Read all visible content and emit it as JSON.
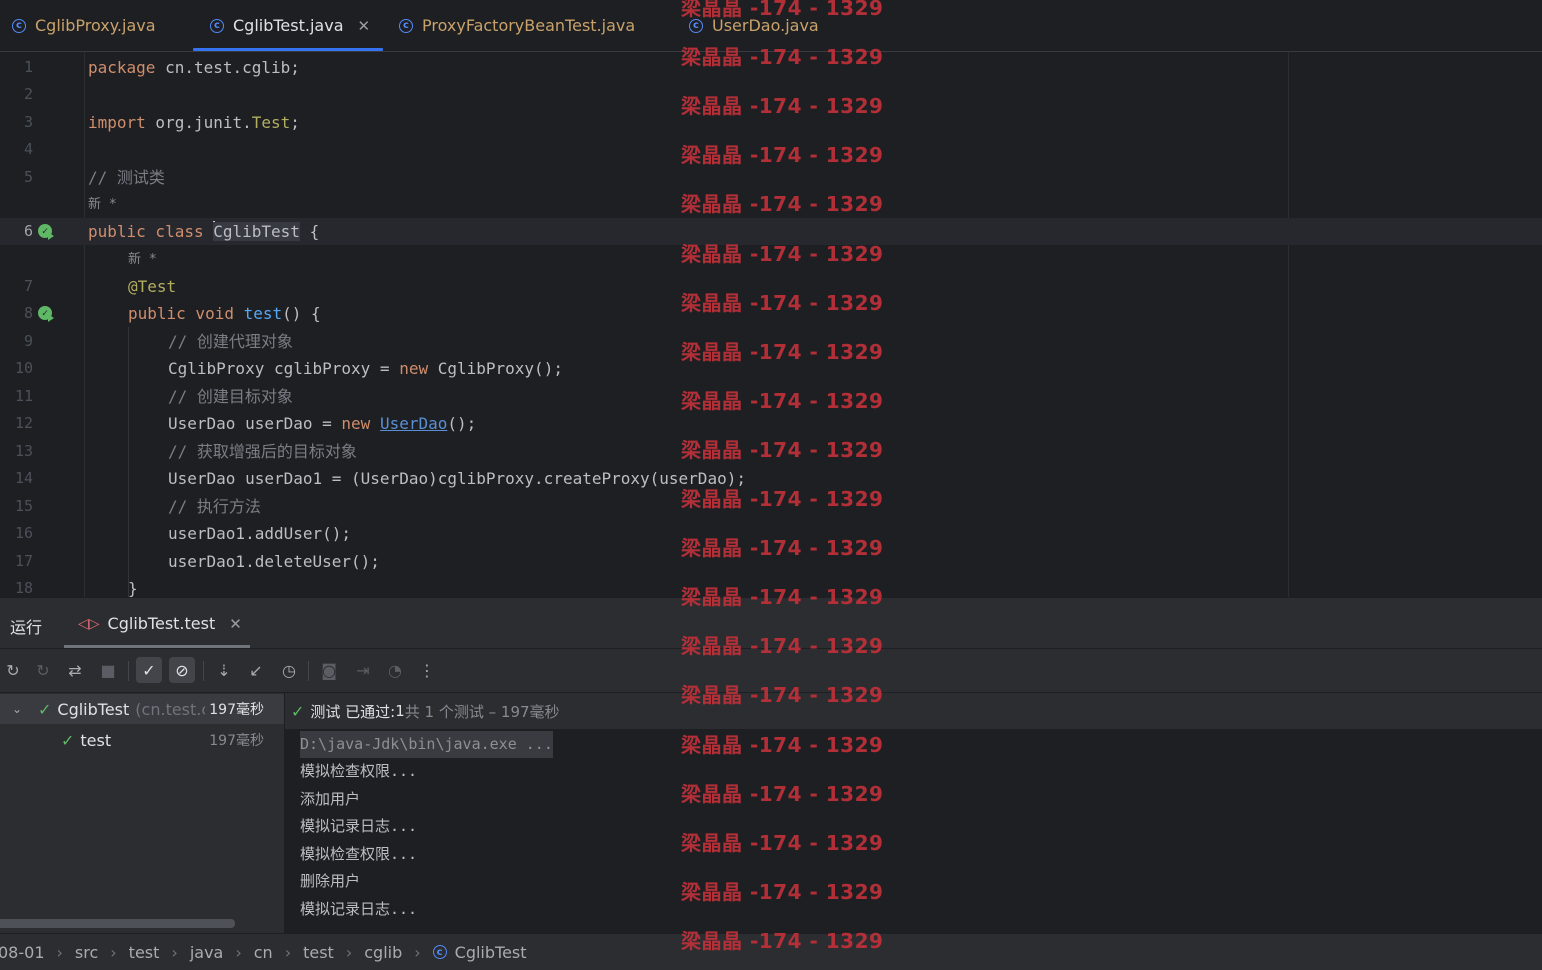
{
  "tabs": [
    {
      "label": "CglibProxy.java",
      "active": false
    },
    {
      "label": "CglibTest.java",
      "active": true
    },
    {
      "label": "ProxyFactoryBeanTest.java",
      "active": false
    },
    {
      "label": "UserDao.java",
      "active": false
    }
  ],
  "editor": {
    "line_numbers": [
      "1",
      "2",
      "3",
      "4",
      "5",
      "6",
      "7",
      "8",
      "9",
      "10",
      "11",
      "12",
      "13",
      "14",
      "15",
      "16",
      "17",
      "18"
    ],
    "hint_new": "新 *",
    "code": {
      "l1_kw": "package",
      "l1_rest": " cn.test.cglib;",
      "l3_kw": "import",
      "l3_rest": " org.junit.",
      "l3_cls": "Test",
      "l3_end": ";",
      "l5_cm": "// 测试类",
      "l6_kw": "public class ",
      "l6_cls": "CglibTest",
      "l6_end": " {",
      "l7_ann": "@Test",
      "l8_kw": "public void ",
      "l8_fn": "test",
      "l8_end": "() {",
      "l9_cm": "// 创建代理对象",
      "l10_a": "CglibProxy cglibProxy = ",
      "l10_kw": "new",
      "l10_b": " CglibProxy();",
      "l11_cm": "// 创建目标对象",
      "l12_a": "UserDao userDao = ",
      "l12_kw": "new",
      "l12_link": "UserDao",
      "l12_b": "();",
      "l13_cm": "// 获取增强后的目标对象",
      "l14": "UserDao userDao1 = (UserDao)cglibProxy.createProxy(userDao);",
      "l15_cm": "// 执行方法",
      "l16": "userDao1.addUser();",
      "l17": "userDao1.deleteUser();",
      "l18": "}"
    }
  },
  "run_panel": {
    "title": "运行",
    "tab_label": "CglibTest.test",
    "tree": {
      "root_label": "CglibTest",
      "root_pkg": "(cn.test.c",
      "root_time": "197毫秒",
      "child_label": "test",
      "child_time": "197毫秒"
    },
    "status": {
      "prefix": "测试 已通过: ",
      "count": "1",
      "suffix": "共 1 个测试 – 197毫秒"
    },
    "console": [
      "D:\\java-Jdk\\bin\\java.exe ...",
      "模拟检查权限...",
      "添加用户",
      "模拟记录日志...",
      "模拟检查权限...",
      "删除用户",
      "模拟记录日志..."
    ]
  },
  "breadcrumb": [
    "08-01",
    "src",
    "test",
    "java",
    "cn",
    "test",
    "cglib",
    "CglibTest"
  ],
  "watermark": "梁晶晶 -174 - 1329"
}
